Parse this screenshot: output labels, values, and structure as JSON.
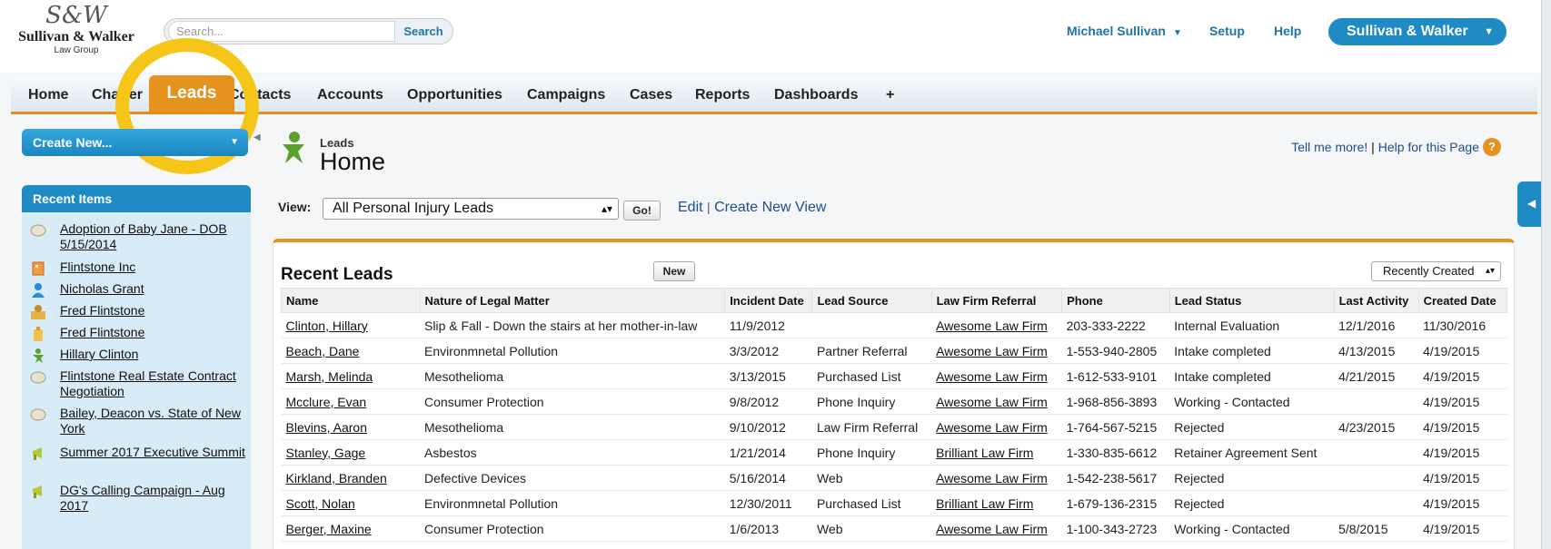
{
  "header": {
    "logo": {
      "monogram": "S&W",
      "name": "Sullivan & Walker",
      "subtitle": "Law Group"
    },
    "search": {
      "placeholder": "Search...",
      "button": "Search"
    },
    "user_name": "Michael Sullivan",
    "links": [
      "Setup",
      "Help"
    ],
    "app_switcher": "Sullivan & Walker"
  },
  "tabs": [
    "Home",
    "Chatter",
    "Leads",
    "Contacts",
    "Accounts",
    "Opportunities",
    "Campaigns",
    "Cases",
    "Reports",
    "Dashboards",
    "+"
  ],
  "active_tab": "Leads",
  "sidebar": {
    "create_new": "Create New...",
    "recent_items_title": "Recent Items",
    "recent_items": [
      {
        "label": "Adoption of Baby Jane - DOB 5/15/2014",
        "icon": "case-icon"
      },
      {
        "label": "Flintstone Inc",
        "icon": "account-icon"
      },
      {
        "label": "Nicholas Grant",
        "icon": "contact-icon"
      },
      {
        "label": "Fred Flintstone",
        "icon": "person-account-icon"
      },
      {
        "label": "Fred Flintstone",
        "icon": "opportunity-icon"
      },
      {
        "label": "Hillary Clinton",
        "icon": "lead-icon"
      },
      {
        "label": "Flintstone Real Estate Contract Negotiation",
        "icon": "case-icon"
      },
      {
        "label": "Bailey, Deacon vs. State of New York",
        "icon": "case-icon"
      },
      {
        "label": "Summer 2017 Executive Summit",
        "icon": "campaign-icon"
      },
      {
        "label": "DG's Calling Campaign - Aug 2017",
        "icon": "campaign-icon"
      }
    ]
  },
  "main": {
    "category": "Leads",
    "title": "Home",
    "help": {
      "tell_me_more": "Tell me more!",
      "separator": "|",
      "help_page": "Help for this Page"
    },
    "view": {
      "label": "View:",
      "selected": "All Personal Injury Leads",
      "go": "Go!",
      "edit": "Edit",
      "separator": "|",
      "create_view": "Create New View"
    },
    "recent_leads": {
      "title": "Recent Leads",
      "new_button": "New",
      "sort": "Recently Created",
      "columns": [
        "Name",
        "Nature of Legal Matter",
        "Incident Date",
        "Lead Source",
        "Law Firm Referral",
        "Phone",
        "Lead Status",
        "Last Activity",
        "Created Date"
      ],
      "rows": [
        [
          "Clinton, Hillary",
          "Slip & Fall - Down the stairs at her mother-in-law",
          "11/9/2012",
          "",
          "Awesome Law Firm",
          "203-333-2222",
          "Internal Evaluation",
          "12/1/2016",
          "11/30/2016"
        ],
        [
          "Beach, Dane",
          "Environmnetal Pollution",
          "3/3/2012",
          "Partner Referral",
          "Awesome Law Firm",
          "1-553-940-2805",
          "Intake completed",
          "4/13/2015",
          "4/19/2015"
        ],
        [
          "Marsh, Melinda",
          "Mesothelioma",
          "3/13/2015",
          "Purchased List",
          "Awesome Law Firm",
          "1-612-533-9101",
          "Intake completed",
          "4/21/2015",
          "4/19/2015"
        ],
        [
          "Mcclure, Evan",
          "Consumer Protection",
          "9/8/2012",
          "Phone Inquiry",
          "Awesome Law Firm",
          "1-968-856-3893",
          "Working - Contacted",
          "",
          "4/19/2015"
        ],
        [
          "Blevins, Aaron",
          "Mesothelioma",
          "9/10/2012",
          "Law Firm Referral",
          "Awesome Law Firm",
          "1-764-567-5215",
          "Rejected",
          "4/23/2015",
          "4/19/2015"
        ],
        [
          "Stanley, Gage",
          "Asbestos",
          "1/21/2014",
          "Phone Inquiry",
          "Brilliant Law Firm",
          "1-330-835-6612",
          "Retainer Agreement Sent",
          "",
          "4/19/2015"
        ],
        [
          "Kirkland, Branden",
          "Defective Devices",
          "5/16/2014",
          "Web",
          "Awesome Law Firm",
          "1-542-238-5617",
          "Rejected",
          "",
          "4/19/2015"
        ],
        [
          "Scott, Nolan",
          "Environmnetal Pollution",
          "12/30/2011",
          "Purchased List",
          "Brilliant Law Firm",
          "1-679-136-2315",
          "Rejected",
          "",
          "4/19/2015"
        ],
        [
          "Berger, Maxine",
          "Consumer Protection",
          "1/6/2013",
          "Web",
          "Awesome Law Firm",
          "1-100-343-2723",
          "Working - Contacted",
          "5/8/2015",
          "4/19/2015"
        ]
      ]
    }
  },
  "colors": {
    "accent": "#e6921f",
    "brand_blue": "#1f8bc4",
    "highlight": "#f5c518",
    "link": "#1f74a8"
  }
}
